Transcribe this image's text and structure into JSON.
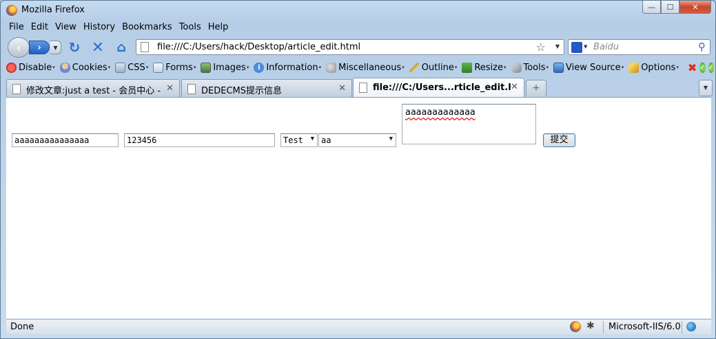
{
  "window": {
    "title": "Mozilla Firefox",
    "min_glyph": "—",
    "max_glyph": "☐",
    "close_glyph": "✕"
  },
  "menu": [
    "File",
    "Edit",
    "View",
    "History",
    "Bookmarks",
    "Tools",
    "Help"
  ],
  "nav": {
    "back_glyph": "‹",
    "forward_glyph": "›",
    "dropdown_glyph": "▼",
    "reload_glyph": "↻",
    "stop_glyph": "✕",
    "home_glyph": "⌂",
    "url": "file:///C:/Users/hack/Desktop/article_edit.html",
    "bookmark_glyph": "☆",
    "search_placeholder": "Baidu",
    "search_glyph": "⚲"
  },
  "devbar": {
    "items": [
      "Disable",
      "Cookies",
      "CSS",
      "Forms",
      "Images",
      "Information",
      "Miscellaneous",
      "Outline",
      "Resize",
      "Tools",
      "View Source",
      "Options"
    ],
    "dropdown_glyph": "▾",
    "info_glyph": "i",
    "error_glyph": "✖",
    "ok_glyph": "✓"
  },
  "tabs": [
    {
      "label": "修改文章:just a test - 会员中心 - ...",
      "close": "✕"
    },
    {
      "label": "DEDECMS提示信息",
      "close": "✕"
    },
    {
      "label": "file:///C:/Users...rticle_edit.html",
      "close": "✕"
    }
  ],
  "tabstrip": {
    "new_tab_glyph": "+",
    "list_glyph": "▼"
  },
  "form": {
    "field1_value": "aaaaaaaaaaaaaaa",
    "field2_value": "123456",
    "select1_value": "Test",
    "select2_value": "aa",
    "select_arrow": "▼",
    "textarea_value": "aaaaaaaaaaaaa",
    "submit_label": "提交"
  },
  "status": {
    "text": "Done",
    "bug_glyph": "✱",
    "server": "Microsoft-IIS/6.0"
  }
}
